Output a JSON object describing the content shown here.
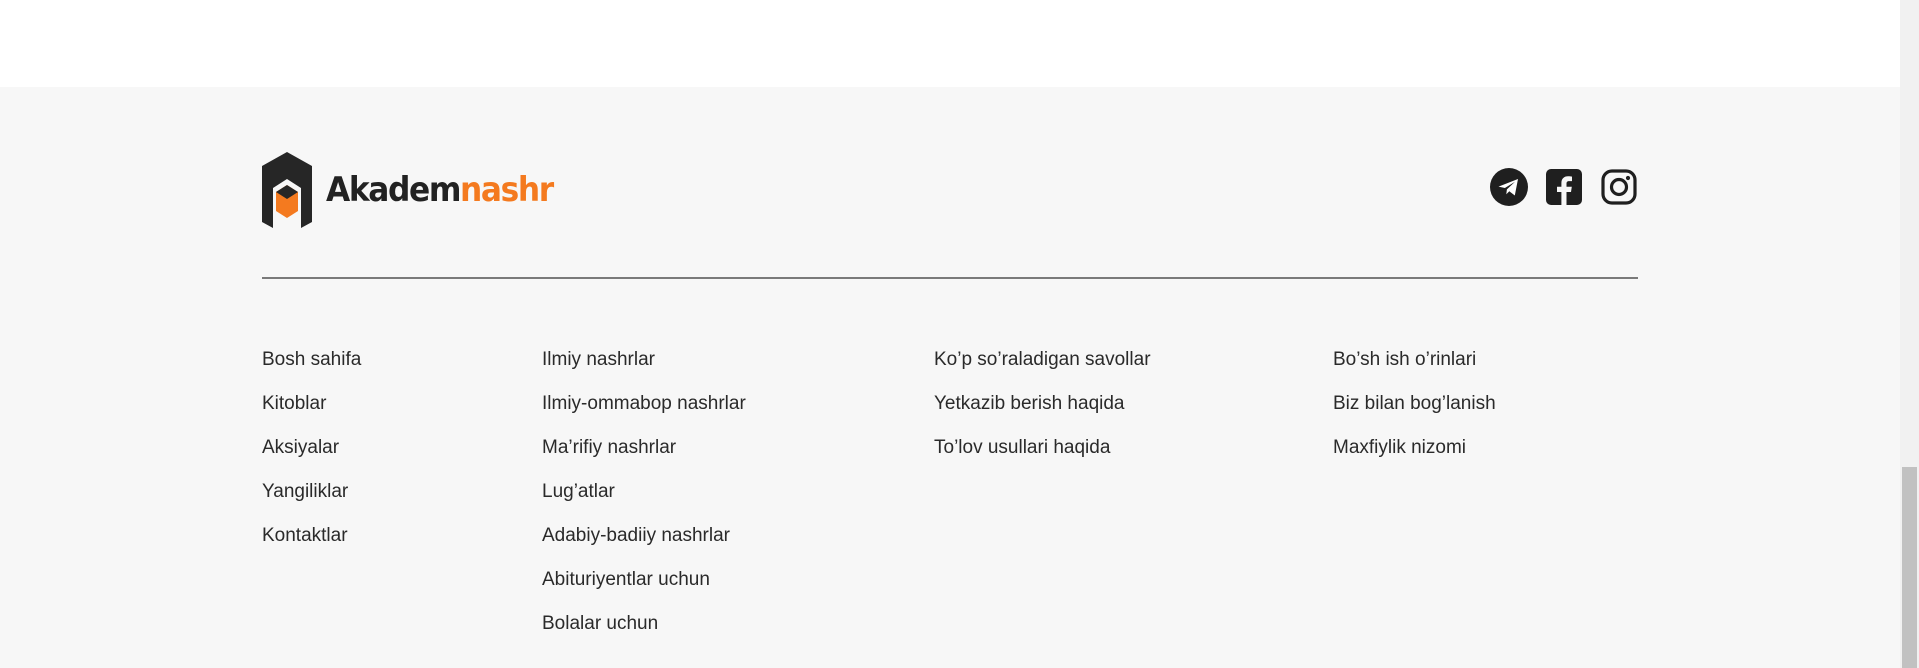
{
  "brand": {
    "name_part1": "Akadem",
    "name_part2": "nashr",
    "colors": {
      "dark": "#222222",
      "accent": "#f47a1f"
    }
  },
  "social": [
    {
      "name": "telegram",
      "icon": "telegram-icon"
    },
    {
      "name": "facebook",
      "icon": "facebook-icon"
    },
    {
      "name": "instagram",
      "icon": "instagram-icon"
    }
  ],
  "columns": [
    {
      "links": [
        "Bosh sahifa",
        "Kitoblar",
        "Aksiyalar",
        "Yangiliklar",
        "Kontaktlar"
      ]
    },
    {
      "links": [
        "Ilmiy nashrlar",
        "Ilmiy-ommabop nashrlar",
        "Ma’rifiy nashrlar",
        "Lug’atlar",
        "Adabiy-badiiy nashrlar",
        "Abituriyentlar uchun",
        "Bolalar uchun"
      ]
    },
    {
      "links": [
        "Ko’p so’raladigan savollar",
        "Yetkazib berish haqida",
        "To’lov usullari haqida"
      ]
    },
    {
      "links": [
        "Bo’sh ish o’rinlari",
        "Biz bilan bog’lanish",
        "Maxfiylik nizomi"
      ]
    }
  ]
}
